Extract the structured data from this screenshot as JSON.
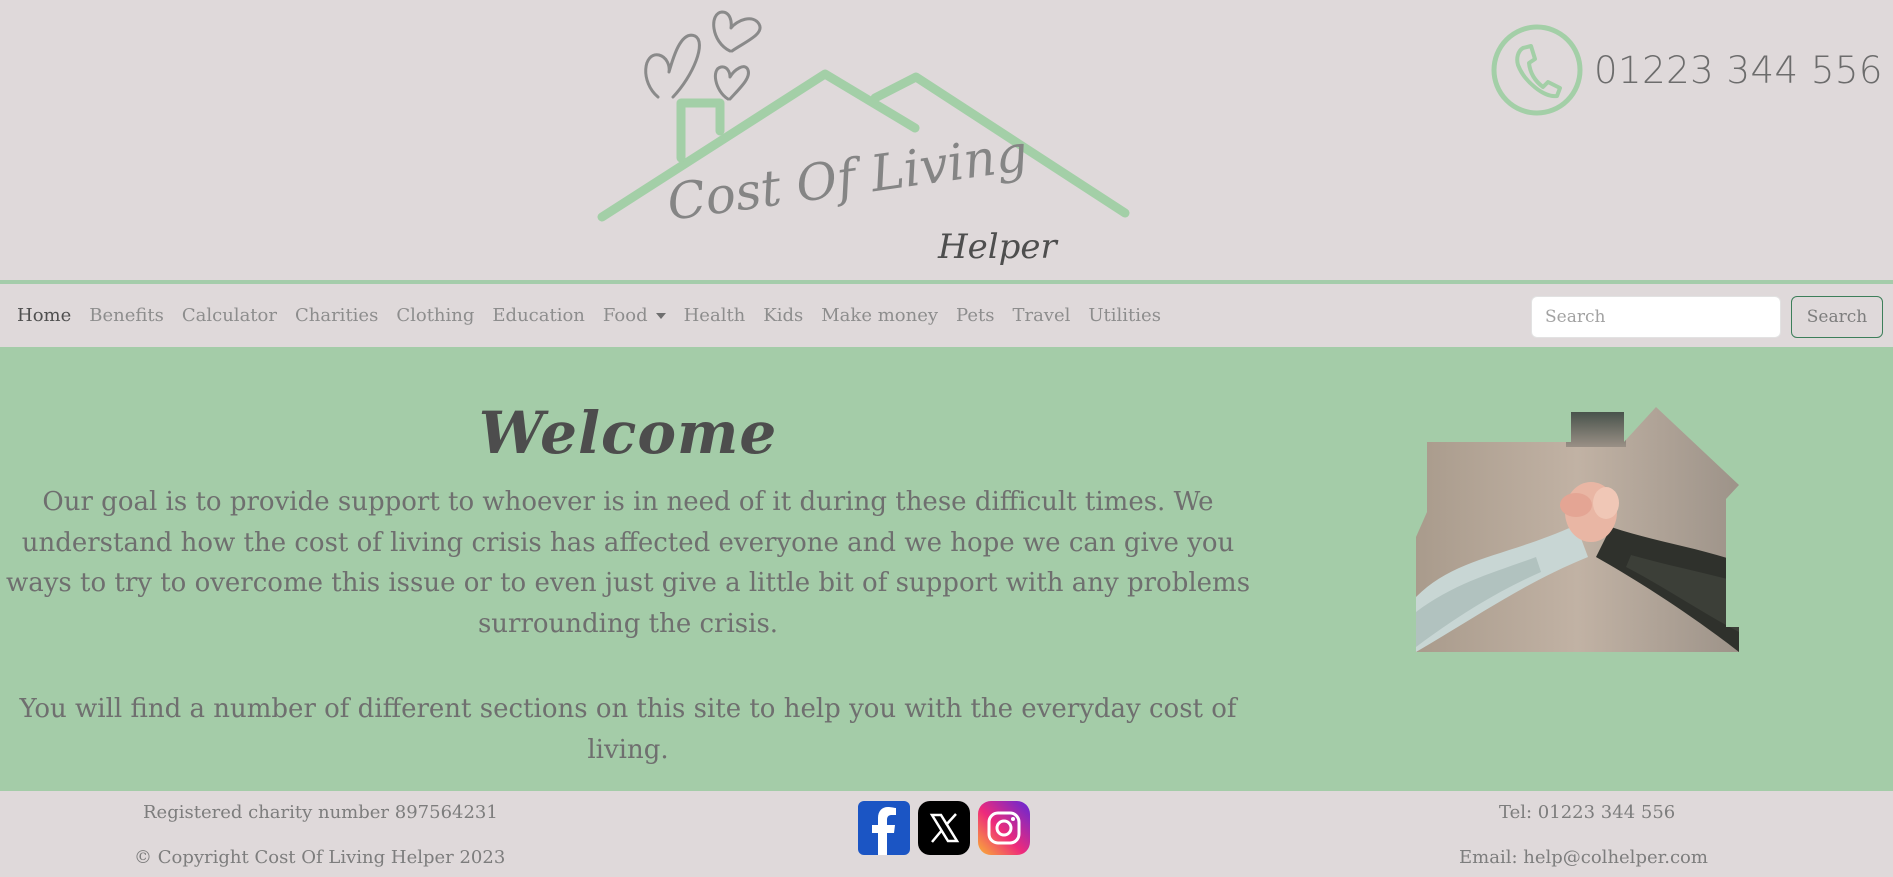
{
  "header": {
    "logo": {
      "line1": "Cost Of Living",
      "line2": "Helper"
    },
    "phone": "01223 344 556",
    "phone_icon": "phone-icon"
  },
  "nav": {
    "items": [
      {
        "label": "Home",
        "active": true
      },
      {
        "label": "Benefits"
      },
      {
        "label": "Calculator"
      },
      {
        "label": "Charities"
      },
      {
        "label": "Clothing"
      },
      {
        "label": "Education"
      },
      {
        "label": "Food",
        "dropdown": true
      },
      {
        "label": "Health"
      },
      {
        "label": "Kids"
      },
      {
        "label": "Make money"
      },
      {
        "label": "Pets"
      },
      {
        "label": "Travel"
      },
      {
        "label": "Utilities"
      }
    ],
    "search_placeholder": "Search",
    "search_button": "Search"
  },
  "main": {
    "title": "Welcome",
    "paragraph1": "Our goal is to provide support to whoever is in need of it during these difficult times. We understand how the cost of living crisis has affected everyone and we hope we can give you ways to try to overcome this issue or to even just give a little bit of support with any problems surrounding the crisis.",
    "paragraph2": "You will find a number of different sections on this site to help you with the everyday cost of living."
  },
  "footer": {
    "charity": "Registered charity number 897564231",
    "copyright": "© Copyright Cost Of Living Helper 2023",
    "tel": "Tel: 01223 344 556",
    "email": "Email: help@colhelper.com",
    "social": [
      "facebook-icon",
      "x-icon",
      "instagram-icon"
    ]
  },
  "colors": {
    "background": "#dfd9da",
    "accent_green": "#a4cca8",
    "logo_green": "#a3cfa7",
    "text_grey": "#6f6f6f",
    "button_border": "#3d7f5a"
  }
}
